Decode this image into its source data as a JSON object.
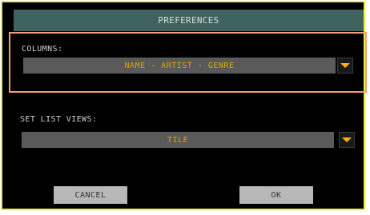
{
  "dialog": {
    "title": "PREFERENCES"
  },
  "columns": {
    "label": "COLUMNS:",
    "selected_value": "NAME - ARTIST - GENRE"
  },
  "set_list_views": {
    "label": "SET LIST VIEWS:",
    "selected_value": "TILE"
  },
  "buttons": {
    "cancel_label": "CANCEL",
    "ok_label": "OK"
  },
  "colors": {
    "title_bar": "#3f6460",
    "dialog_border": "#e4f33a",
    "section_highlight_border": "#f0a072",
    "select_text": "#d9a800",
    "dropdown_arrow": "#ffb400",
    "button_bg": "#b8b8b8"
  },
  "icons": {
    "dropdown": "triangle-down-icon"
  }
}
